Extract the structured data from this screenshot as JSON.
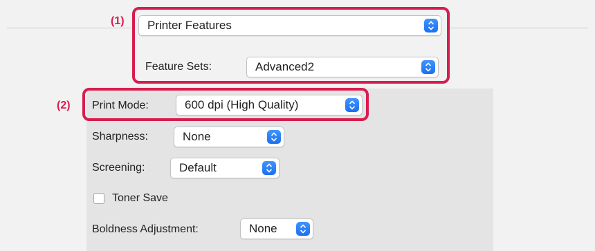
{
  "callouts": {
    "one": "(1)",
    "two": "(2)"
  },
  "printer_features_popup": {
    "value": "Printer Features"
  },
  "feature_sets": {
    "label": "Feature Sets:",
    "value": "Advanced2"
  },
  "print_mode": {
    "label": "Print Mode:",
    "value": "600 dpi (High Quality)"
  },
  "sharpness": {
    "label": "Sharpness:",
    "value": "None"
  },
  "screening": {
    "label": "Screening:",
    "value": "Default"
  },
  "toner_save": {
    "label": "Toner Save",
    "checked": false
  },
  "boldness_adjustment": {
    "label": "Boldness Adjustment:",
    "value": "None"
  },
  "colors": {
    "highlight": "#d81d4e",
    "accent": "#2a7df5",
    "panel": "#e4e4e4",
    "background": "#f2f2f2"
  },
  "icons": {
    "popup_arrows": "up-down-chevron-icon"
  }
}
